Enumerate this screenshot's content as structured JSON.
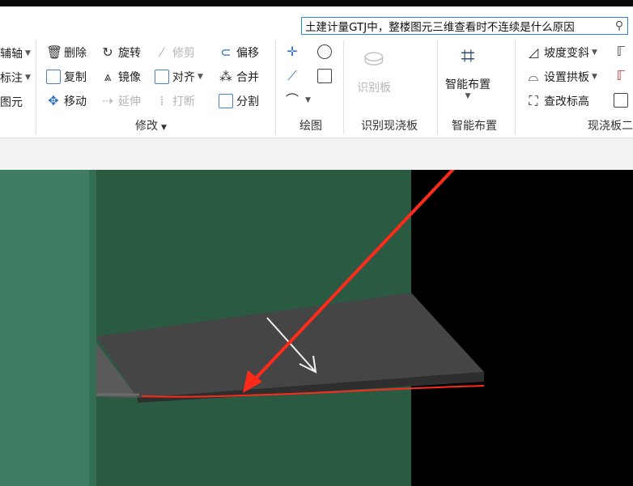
{
  "search": {
    "text": "土建计量GTJ中，整楼图元三维查看时不连续是什么原因"
  },
  "ribbon": {
    "left_partial": [
      "辅轴",
      "标注",
      "图元"
    ],
    "modify": {
      "delete": "删除",
      "rotate": "旋转",
      "trim": "修剪",
      "offset": "偏移",
      "copy": "复制",
      "mirror": "镜像",
      "align": "对齐",
      "merge": "合并",
      "move": "移动",
      "extend": "延伸",
      "break": "打断",
      "split": "分割",
      "group_label": "修改"
    },
    "draw": {
      "group_label": "绘图"
    },
    "identify": {
      "button": "识别板",
      "group_label": "识别现浇板"
    },
    "smart": {
      "button": "智能布置",
      "group_label": "智能布置"
    },
    "slab": {
      "slope": "坡度变斜",
      "arch": "设置拱板",
      "elevation": "查改标高",
      "group_label": "现浇板二"
    }
  },
  "colors": {
    "wall_light": "#3f7d62",
    "wall_dark": "#2b5a43",
    "slab": "#454545",
    "annotation_red": "#ff2a1a"
  }
}
